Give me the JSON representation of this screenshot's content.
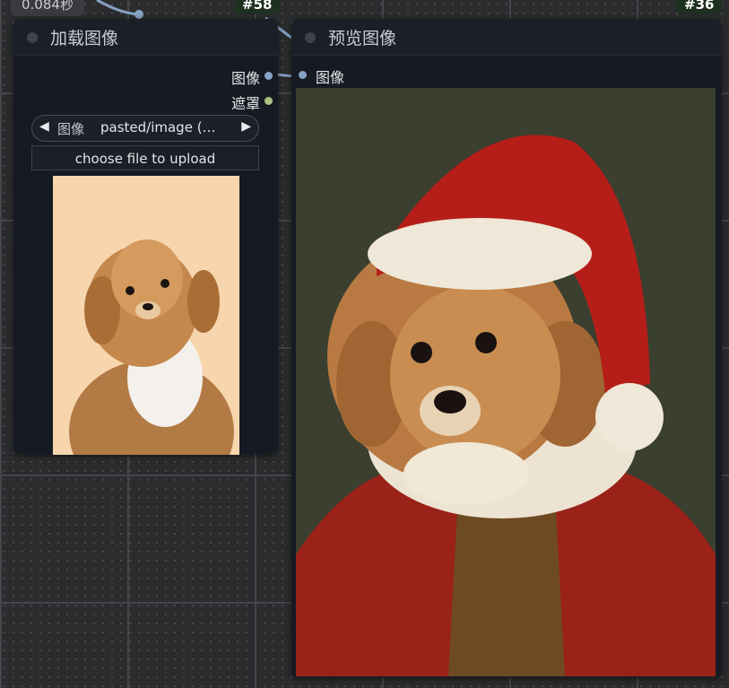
{
  "timer": {
    "label": "0.084秒"
  },
  "badges": {
    "load_node": "#58",
    "preview_node": "#36"
  },
  "load_node": {
    "title": "加载图像",
    "outputs": [
      {
        "label": "图像",
        "color": "#86a2c4"
      },
      {
        "label": "遮罩",
        "color": "#a9c283"
      }
    ],
    "combo": {
      "label": "图像",
      "value": "pasted/image (…",
      "prev_icon": "triangle-left-icon",
      "next_icon": "triangle-right-icon"
    },
    "upload_label": "choose file to upload"
  },
  "preview_node": {
    "title": "预览图像",
    "input": {
      "label": "图像",
      "color": "#86a2c4"
    }
  },
  "colors": {
    "canvas": "#2b2c2e",
    "node_body": "#161a22",
    "badge": "#1e3020",
    "link": "#86a2c4"
  }
}
